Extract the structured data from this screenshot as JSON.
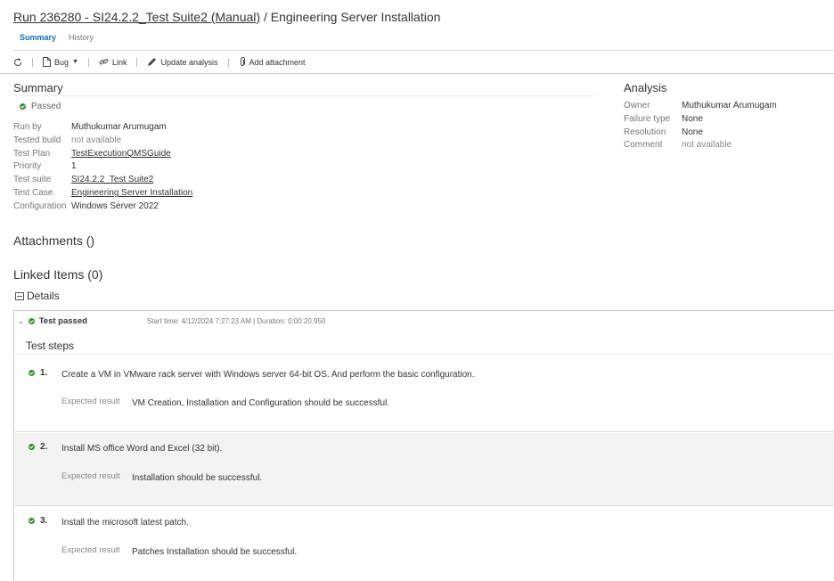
{
  "header": {
    "run_link": "Run 236280 - SI24.2.2_Test Suite2 (Manual)",
    "separator": " / ",
    "title": "Engineering Server Installation"
  },
  "tabs": [
    {
      "label": "Summary",
      "active": true
    },
    {
      "label": "History",
      "active": false
    }
  ],
  "toolbar": {
    "refresh_icon": "refresh-icon",
    "bug_label": "Bug",
    "link_label": "Link",
    "update_label": "Update analysis",
    "attach_label": "Add attachment"
  },
  "summary": {
    "heading": "Summary",
    "status": "Passed",
    "fields": [
      {
        "key": "Run by",
        "value": "Muthukumar Arumugam",
        "kind": "text"
      },
      {
        "key": "Tested build",
        "value": "not available",
        "kind": "muted"
      },
      {
        "key": "Test Plan",
        "value": "TestExecutionQMSGuide",
        "kind": "link"
      },
      {
        "key": "Priority",
        "value": "1",
        "kind": "text"
      },
      {
        "key": "Test suite",
        "value": "SI24.2.2_Test Suite2",
        "kind": "link"
      },
      {
        "key": "Test Case",
        "value": "Engineering Server Installation",
        "kind": "link"
      },
      {
        "key": "Configuration",
        "value": "Windows Server 2022",
        "kind": "text"
      }
    ]
  },
  "analysis": {
    "heading": "Analysis",
    "fields": [
      {
        "key": "Owner",
        "value": "Muthukumar Arumugam",
        "kind": "text"
      },
      {
        "key": "Failure type",
        "value": "None",
        "kind": "text"
      },
      {
        "key": "Resolution",
        "value": "None",
        "kind": "text"
      },
      {
        "key": "Comment",
        "value": "not available",
        "kind": "muted"
      }
    ]
  },
  "attachments_heading": "Attachments ()",
  "linked_heading": "Linked Items (0)",
  "details_label": "Details",
  "result": {
    "label": "Test passed",
    "meta": "Start time: 4/12/2024 7:27:23 AM | Duration: 0:00:20.950",
    "steps_heading": "Test steps",
    "expected_label": "Expected result",
    "steps": [
      {
        "num": "1.",
        "action": "Create a VM in VMware rack server with Windows server 64-bit OS. And perform the basic configuration.",
        "expected": "VM Creation, Installation and Configuration should be successful."
      },
      {
        "num": "2.",
        "action": "Install MS office  Word and Excel (32 bit).",
        "expected": "Installation should be successful."
      },
      {
        "num": "3.",
        "action": "Install the microsoft latest patch.",
        "expected": "Patches Installation should be successful."
      }
    ]
  },
  "colors": {
    "accent": "#106ebe",
    "pass": "#3a8a34"
  }
}
